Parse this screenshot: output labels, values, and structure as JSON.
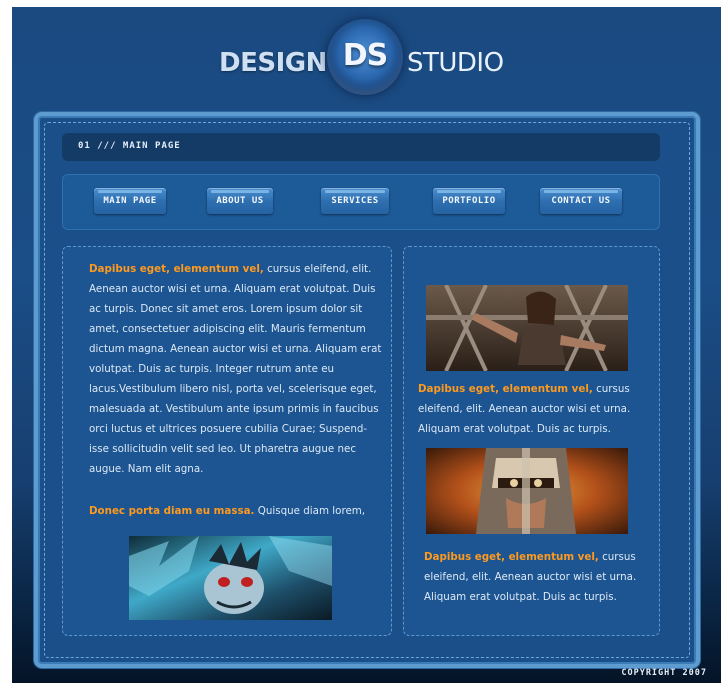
{
  "header": {
    "logo_left": "DESIGN",
    "logo_mark": "DS",
    "logo_right": "STUDIO"
  },
  "breadcrumb": "01  ///  MAIN PAGE",
  "nav": {
    "items": [
      {
        "label": "MAIN PAGE"
      },
      {
        "label": "ABOUT US"
      },
      {
        "label": "SERVICES"
      },
      {
        "label": "PORTFOLIO"
      },
      {
        "label": "CONTACT US"
      }
    ]
  },
  "left": {
    "para1_highlight": "Dapibus eget, elementum vel,",
    "para1_text": " cursus eleifend, elit. Aenean auctor wisi et urna. Aliquam erat volutpat. Duis ac turpis. Donec sit amet eros. Lorem ipsum dolor sit amet, consectetuer adipiscing elit. Mauris fermentum dictum magna. Aenean auctor wisi et urna. Aliquam erat volutpat. Duis ac turpis. Integer rutrum ante eu lacus.Vestibulum libero nisl, porta vel, scelerisque eget, malesuada at. Vestibulum ante ipsum primis in faucibus orci luctus et ultrices posuere cubilia Curae; Suspend-isse sollicitudin velit sed leo. Ut pharetra augue nec augue. Nam elit agna.",
    "para2_highlight": "Donec porta diam eu massa.",
    "para2_text": " Quisque diam lorem,"
  },
  "right": {
    "para1_highlight": "Dapibus eget, elementum vel,",
    "para1_text": " cursus eleifend, elit. Aenean auctor wisi et urna. Aliquam erat volutpat. Duis ac turpis.",
    "para2_highlight": "Dapibus eget, elementum vel,",
    "para2_text": " cursus eleifend, elit. Aenean auctor wisi et urna. Aliquam erat volutpat. Duis ac turpis."
  },
  "footer": {
    "copyright": "COPYRIGHT 2007"
  },
  "colors": {
    "background": "#1a4a80",
    "highlight": "#ff9a1e",
    "frame": "#5e9cd0"
  }
}
